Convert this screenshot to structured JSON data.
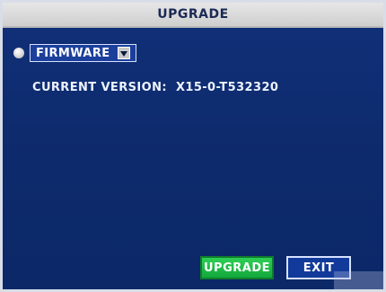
{
  "window": {
    "title": "UPGRADE"
  },
  "upgrade": {
    "source": {
      "selected": "FIRMWARE"
    },
    "current_version": {
      "label": "CURRENT VERSION:",
      "value": "X15-0-T532320"
    }
  },
  "actions": {
    "upgrade_label": "UPGRADE",
    "exit_label": "EXIT"
  },
  "icons": {
    "radio": "radio-button-icon",
    "dropdown": "chevron-down-icon"
  },
  "colors": {
    "background": "#0e2b6f",
    "title_bar": "#dcdcdc",
    "upgrade_button": "#1fbf4a",
    "exit_button": "#123a9a",
    "text": "#eef3ff"
  }
}
